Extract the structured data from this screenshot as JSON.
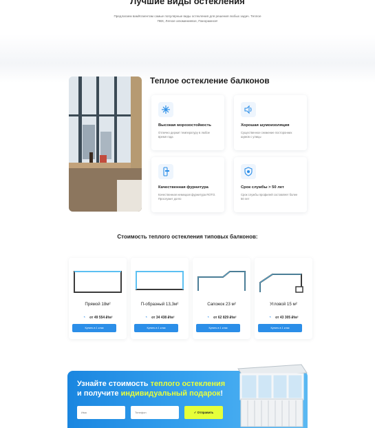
{
  "hero": {
    "title": "Лучшие виды остекления",
    "subtitle": "Предлагаем вам/Клиентам самые популярные виды остекления для решения любых задач. Теплое ПВХ, Легкое алюминиевое, Панорамное!"
  },
  "warm": {
    "title": "Теплое остекление балконов",
    "features": [
      {
        "icon": "snowflake-icon",
        "title": "Высокая морозостойкость",
        "desc": "Отлично держит температуру в любое время года"
      },
      {
        "icon": "sound-icon",
        "title": "Хорошая шумоизоляция",
        "desc": "Существенное снижение посторонних шумов с улицы"
      },
      {
        "icon": "handle-icon",
        "title": "Качественная фурнитура",
        "desc": "Качественная немецкая фурнитура ROTO. Прослужит долго"
      },
      {
        "icon": "shield-icon",
        "title": "Срок службы > 50 лет",
        "desc": "Срок службы профилей составляет более 50 лет"
      }
    ]
  },
  "pricing": {
    "title": "Стоимость теплого остекления типовых балконов:",
    "items": [
      {
        "name": "Прямой 18м²",
        "price": "от 49 554 ₽/м²",
        "button": "Купить в 1 клик"
      },
      {
        "name": "П-образный 13,3м²",
        "price": "от 34 438 ₽/м²",
        "button": "Купить в 1 клик"
      },
      {
        "name": "Сапожок 23 м²",
        "price": "от 62 829 ₽/м²",
        "button": "Купить в 1 клик"
      },
      {
        "name": "Угловой 15 м²",
        "price": "от 43 305 ₽/м²",
        "button": "Купить в 1 клик"
      }
    ]
  },
  "cta": {
    "line1_a": "Узнайте стоимость ",
    "line1_b": "теплого остекления",
    "line2_a": "и получите ",
    "line2_b": "индивидуальный подарок",
    "line2_c": "!",
    "name_placeholder": "Имя",
    "phone_placeholder": "Телефон",
    "send_label": "Отправить"
  },
  "colors": {
    "accent_blue": "#2b8ee8",
    "accent_yellow": "#e6ff3a"
  }
}
